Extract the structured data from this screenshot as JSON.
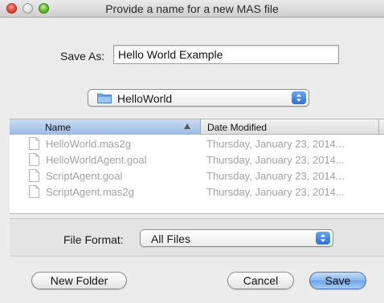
{
  "window": {
    "title": "Provide a name for a new MAS file"
  },
  "save_as": {
    "label": "Save As:",
    "value": "Hello World Example"
  },
  "location": {
    "folder": "HelloWorld",
    "icon": "folder-icon"
  },
  "file_list": {
    "columns": [
      "Name",
      "Date Modified"
    ],
    "sorted_by": "Name",
    "rows": [
      {
        "name": "HelloWorld.mas2g",
        "date": "Thursday, January 23, 2014..."
      },
      {
        "name": "HelloWorldAgent.goal",
        "date": "Thursday, January 23, 2014..."
      },
      {
        "name": "ScriptAgent.goal",
        "date": "Thursday, January 23, 2014..."
      },
      {
        "name": "ScriptAgent.mas2g",
        "date": "Thursday, January 23, 2014..."
      }
    ]
  },
  "file_format": {
    "label": "File Format:",
    "selected": "All Files"
  },
  "buttons": {
    "new_folder": "New Folder",
    "cancel": "Cancel",
    "save": "Save"
  },
  "colors": {
    "accent": "#6ea3e6",
    "disabled_text": "#a3a3a3"
  }
}
